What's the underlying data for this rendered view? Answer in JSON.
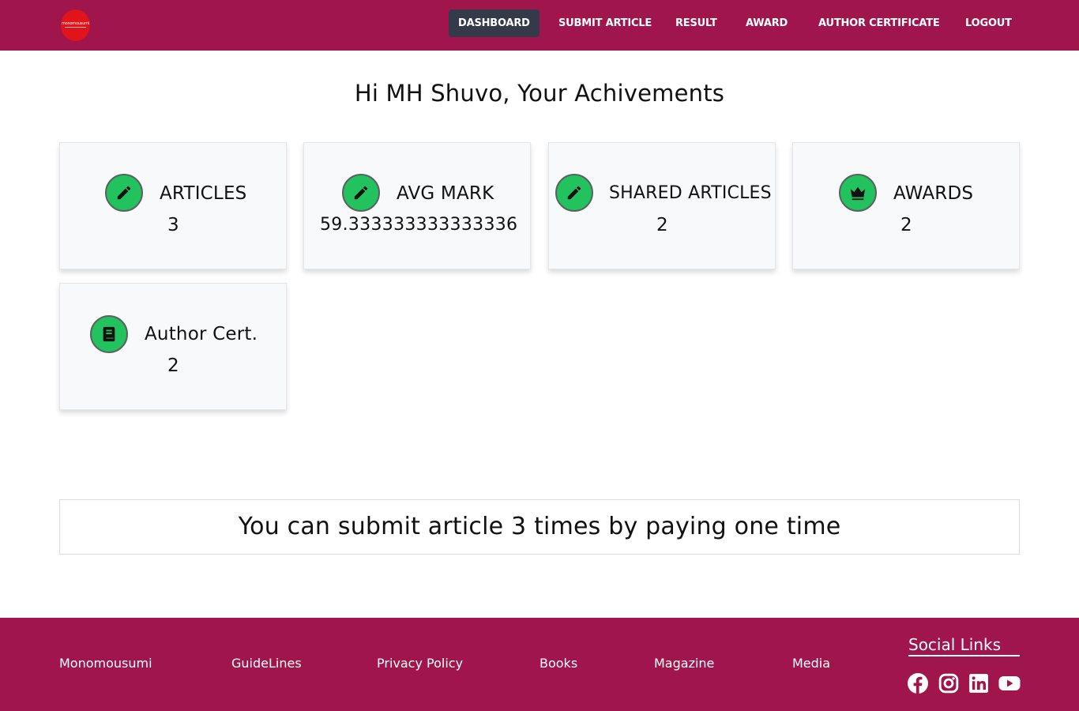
{
  "brand": {
    "logo_text": "monomousumi"
  },
  "nav": {
    "items": [
      {
        "label": "DASHBOARD",
        "active": true
      },
      {
        "label": "SUBMIT ARTICLE"
      },
      {
        "label": "RESULT"
      },
      {
        "label": "AWARD"
      },
      {
        "label": "AUTHOR CERTIFICATE"
      },
      {
        "label": "LOGOUT"
      }
    ]
  },
  "page": {
    "title": "Hi MH Shuvo, Your Achivements"
  },
  "cards": [
    {
      "label": "ARTICLES",
      "value": "3",
      "icon": "pencil-icon"
    },
    {
      "label": "AVG MARK",
      "value": "59.333333333333336",
      "icon": "pencil-icon"
    },
    {
      "label": "SHARED ARTICLES",
      "value": "2",
      "icon": "pencil-icon"
    },
    {
      "label": "AWARDS",
      "value": "2",
      "icon": "crown-icon"
    },
    {
      "label": "Author Cert.",
      "value": "2",
      "icon": "book-icon"
    }
  ],
  "info": {
    "text": "You can submit article 3 times by paying one time"
  },
  "footer": {
    "links": [
      "Monomousumi",
      "GuideLines",
      "Privacy Policy",
      "Books",
      "Magazine",
      "Media"
    ],
    "social_title": "Social Links",
    "social_icons": [
      "facebook-icon",
      "instagram-icon",
      "linkedin-icon",
      "youtube-icon"
    ]
  },
  "colors": {
    "brand": "#a0164c",
    "active_nav": "#343a4a",
    "icon_green": "#22c35e",
    "card_bg": "#f8f9fa"
  }
}
